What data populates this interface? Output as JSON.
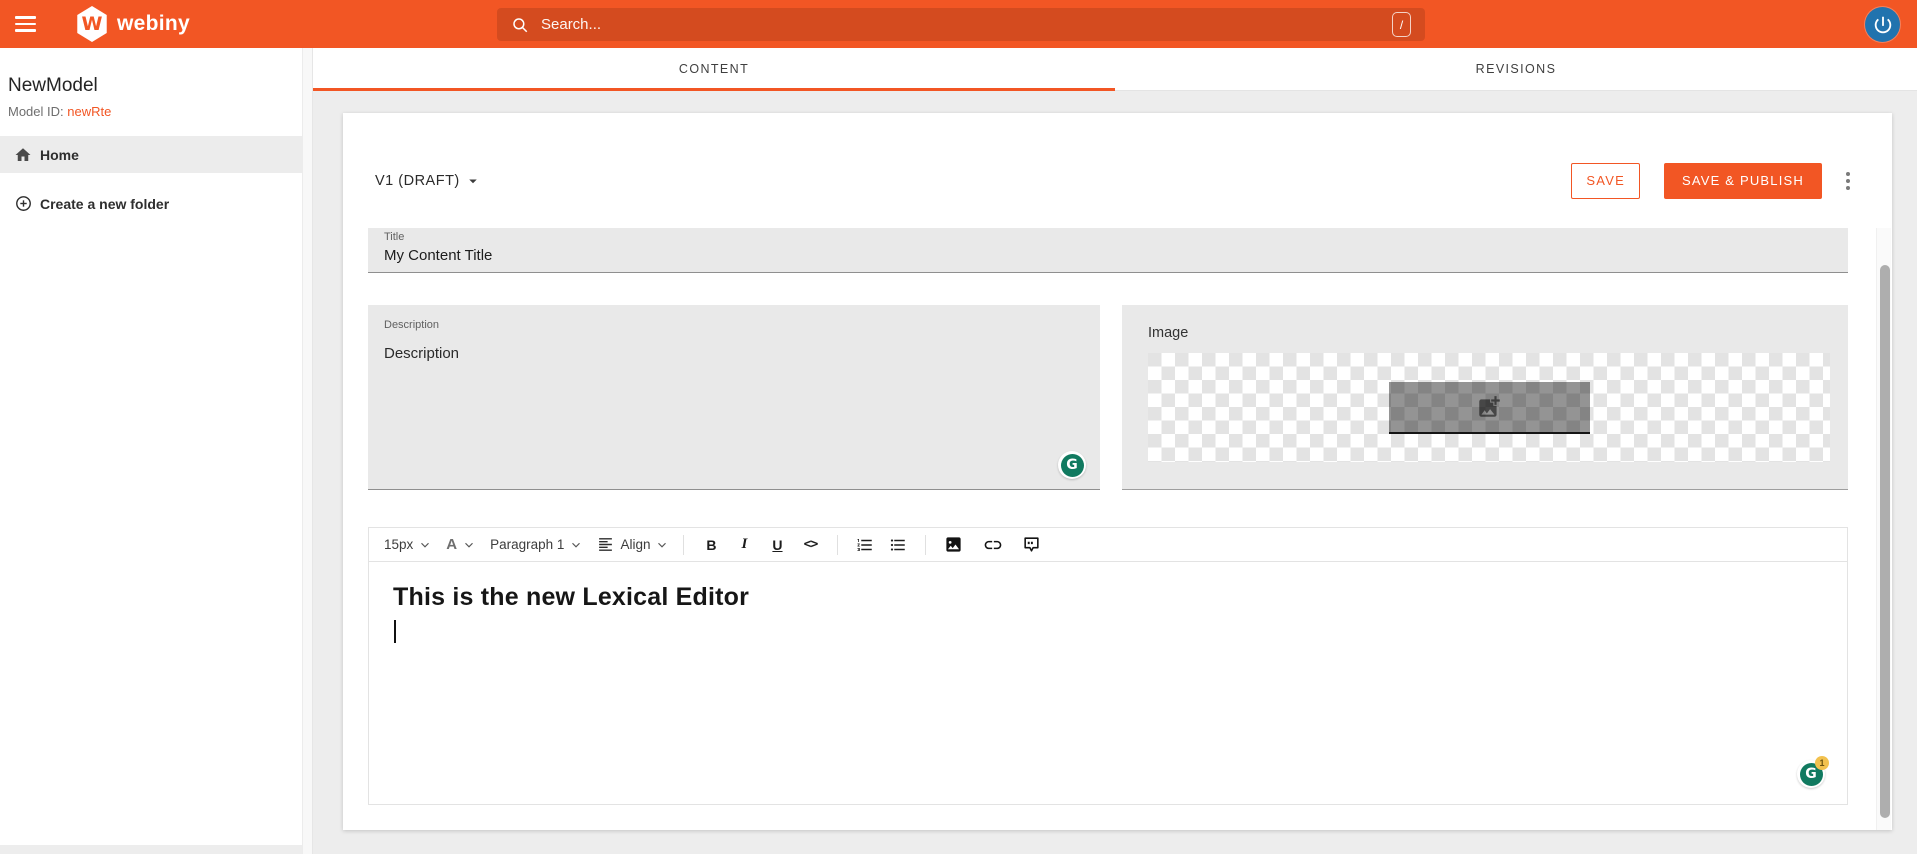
{
  "colors": {
    "accent": "#f25624",
    "grammarly_green": "#117a60",
    "avatar_blue": "#2173ae"
  },
  "topbar": {
    "logo_text": "webiny",
    "search_placeholder": "Search...",
    "search_shortcut": "/"
  },
  "sidebar": {
    "title": "NewModel",
    "model_id_label": "Model ID:",
    "model_id_value": "newRte",
    "nav": [
      {
        "label": "Home"
      },
      {
        "label": "Create a new folder"
      }
    ]
  },
  "tabs": {
    "content": "CONTENT",
    "revisions": "REVISIONS"
  },
  "header": {
    "version": "V1 (DRAFT)",
    "save": "SAVE",
    "save_publish": "SAVE & PUBLISH"
  },
  "form": {
    "title": {
      "label": "Title",
      "value": "My Content Title"
    },
    "description": {
      "label": "Description",
      "placeholder": "Description"
    },
    "image": {
      "label": "Image"
    }
  },
  "rte": {
    "toolbar": {
      "font_size": "15px",
      "font_color_glyph": "A",
      "typography": "Paragraph 1",
      "align_label": "Align",
      "bold": "B",
      "italic": "I",
      "underline": "U",
      "code_glyph": "<>"
    },
    "heading": "This is the new Lexical Editor",
    "grammarly_alert_count": "1"
  }
}
